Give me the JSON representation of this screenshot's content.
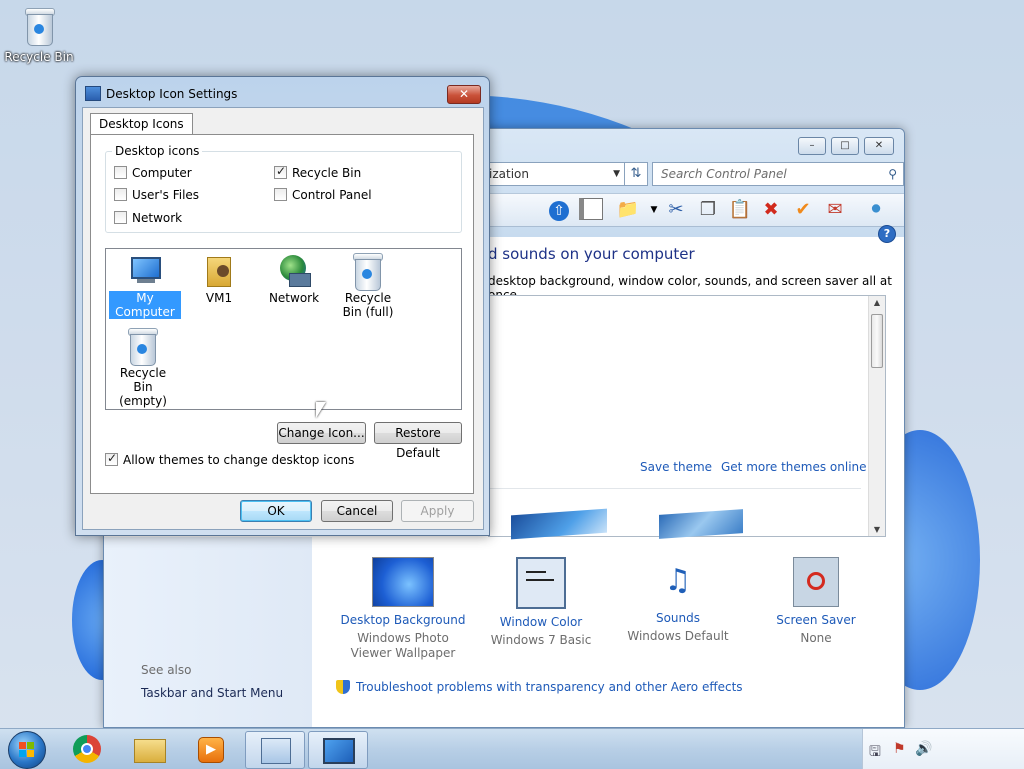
{
  "desktop": {
    "recycle_bin_label": "Recycle Bin"
  },
  "control_panel": {
    "address_text": "ization",
    "search_placeholder": "Search Control Panel",
    "heading": "d sounds on your computer",
    "subheading": "desktop background, window color, sounds, and screen saver all at once.",
    "save_theme": "Save theme",
    "get_more_themes": "Get more themes online",
    "see_also": "See also",
    "taskbar_link": "Taskbar and Start Menu",
    "troubleshoot_link": "Troubleshoot problems with transparency and other Aero effects",
    "tiles": [
      {
        "title": "Desktop Background",
        "subtitle": "Windows Photo Viewer Wallpaper"
      },
      {
        "title": "Window Color",
        "subtitle": "Windows 7 Basic"
      },
      {
        "title": "Sounds",
        "subtitle": "Windows Default"
      },
      {
        "title": "Screen Saver",
        "subtitle": "None"
      }
    ]
  },
  "dialog": {
    "title": "Desktop Icon Settings",
    "tab": "Desktop Icons",
    "group_label": "Desktop icons",
    "checkboxes": [
      {
        "label": "Computer",
        "checked": false
      },
      {
        "label": "Recycle Bin",
        "checked": true
      },
      {
        "label": "User's Files",
        "checked": false
      },
      {
        "label": "Control Panel",
        "checked": false
      },
      {
        "label": "Network",
        "checked": false
      }
    ],
    "icons": [
      {
        "label": "My Computer",
        "selected": true
      },
      {
        "label": "VM1"
      },
      {
        "label": "Network"
      },
      {
        "label": "Recycle Bin (full)"
      },
      {
        "label": "Recycle Bin (empty)"
      }
    ],
    "change_icon": "Change Icon...",
    "restore_default": "Restore Default",
    "allow_themes": "Allow themes to change desktop icons",
    "allow_themes_checked": true,
    "ok": "OK",
    "cancel": "Cancel",
    "apply": "Apply"
  },
  "taskbar": {
    "items": [
      "start-orb",
      "chrome",
      "explorer",
      "media-player",
      "control-panel",
      "display-settings"
    ]
  }
}
